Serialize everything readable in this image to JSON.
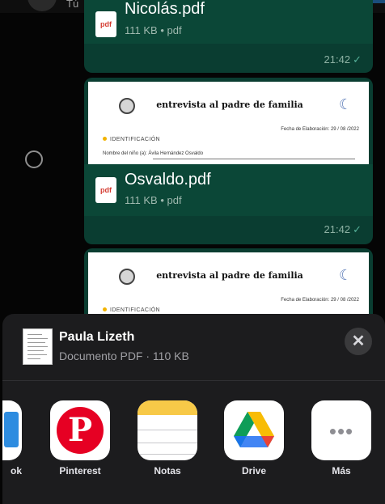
{
  "chat": {
    "top_label": "Tú",
    "messages": [
      {
        "file_name": "Nicolás.pdf",
        "file_meta": "111 KB • pdf",
        "time": "21:42",
        "icon_label": "pdf"
      },
      {
        "file_name": "Osvaldo.pdf",
        "file_meta": "111 KB • pdf",
        "time": "21:42",
        "icon_label": "pdf",
        "preview": {
          "title": "entrevista al padre de familia",
          "date_line": "Fecha de Elaboración: 29 / 08 /2022",
          "section": "IDENTIFICACIÓN",
          "name_line": "Nombre del niño (a): Ávila Hernández Osvaldo"
        }
      },
      {
        "preview": {
          "title": "entrevista al padre de familia",
          "date_line": "Fecha de Elaboración: 29 / 08 /2022",
          "section": "IDENTIFICACIÓN"
        }
      }
    ]
  },
  "share_sheet": {
    "title": "Paula Lizeth",
    "subtitle": "Documento PDF · 110 KB",
    "close_symbol": "✕",
    "apps": [
      {
        "label": "ok",
        "icon": "partial-app-icon"
      },
      {
        "label": "Pinterest",
        "icon": "pinterest-icon"
      },
      {
        "label": "Notas",
        "icon": "notes-icon"
      },
      {
        "label": "Drive",
        "icon": "google-drive-icon"
      },
      {
        "label": "Más",
        "icon": "more-icon"
      }
    ],
    "more_symbol": "•••",
    "pinterest_symbol": "P"
  },
  "colors": {
    "bubble": "#0a3d31",
    "file_info": "#0b4737",
    "sheet_bg": "#1c1c1e",
    "pinterest": "#e60023",
    "notes_yellow": "#f7c948"
  }
}
